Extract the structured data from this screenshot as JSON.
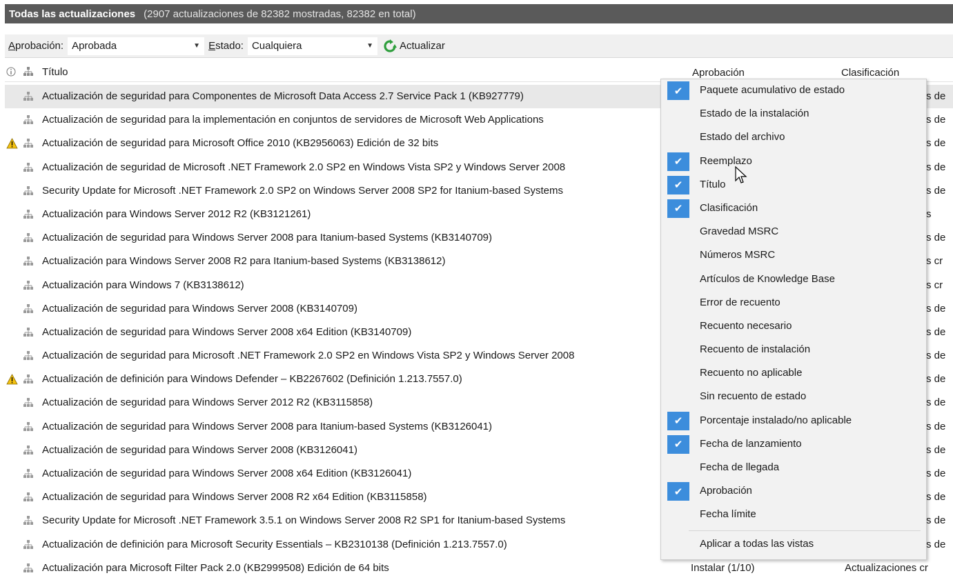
{
  "window": {
    "title": "Todas las actualizaciones",
    "subtitle": "(2907 actualizaciones de 82382 mostradas, 82382 en total)"
  },
  "toolbar": {
    "approval_label": "Aprobación:",
    "approval_value": "Aprobada",
    "status_label": "Estado:",
    "status_value": "Cualquiera",
    "refresh_label": "Actualizar"
  },
  "columns": {
    "title": "Título",
    "approval": "Aprobación",
    "classification": "Clasificación"
  },
  "rows": [
    {
      "title": "Actualización de seguridad para Componentes de Microsoft Data Access 2.7 Service Pack 1 (KB927779)",
      "warning": false,
      "selected": true,
      "approval": "",
      "classification": "s de"
    },
    {
      "title": "Actualización de seguridad para la implementación en conjuntos de servidores de Microsoft Web Applications",
      "warning": false,
      "approval": "",
      "classification": "s de"
    },
    {
      "title": "Actualización de seguridad para Microsoft Office 2010 (KB2956063) Edición de 32 bits",
      "warning": true,
      "approval": "",
      "classification": "s de"
    },
    {
      "title": "Actualización de seguridad de Microsoft .NET Framework 2.0 SP2 en Windows Vista SP2 y Windows Server 2008",
      "warning": false,
      "approval": "",
      "classification": "s de"
    },
    {
      "title": "Security Update for Microsoft .NET Framework 2.0 SP2 on Windows Server 2008 SP2 for Itanium-based Systems",
      "warning": false,
      "approval": "",
      "classification": "s de"
    },
    {
      "title": "Actualización para Windows Server 2012 R2 (KB3121261)",
      "warning": false,
      "approval": "",
      "classification": "s"
    },
    {
      "title": "Actualización de seguridad para Windows Server 2008 para Itanium-based Systems (KB3140709)",
      "warning": false,
      "approval": "",
      "classification": "s de"
    },
    {
      "title": "Actualización para Windows Server 2008 R2 para Itanium-based Systems (KB3138612)",
      "warning": false,
      "approval": "",
      "classification": "s cr"
    },
    {
      "title": "Actualización para Windows 7 (KB3138612)",
      "warning": false,
      "approval": "",
      "classification": "s cr"
    },
    {
      "title": "Actualización de seguridad para Windows Server 2008 (KB3140709)",
      "warning": false,
      "approval": "",
      "classification": "s de"
    },
    {
      "title": "Actualización de seguridad para Windows Server 2008 x64 Edition (KB3140709)",
      "warning": false,
      "approval": "",
      "classification": "s de"
    },
    {
      "title": "Actualización de seguridad para Microsoft .NET Framework 2.0 SP2 en Windows Vista SP2 y Windows Server 2008",
      "warning": false,
      "approval": "",
      "classification": "s de"
    },
    {
      "title": "Actualización de definición para Windows Defender – KB2267602 (Definición 1.213.7557.0)",
      "warning": true,
      "approval": "",
      "classification": "s de"
    },
    {
      "title": "Actualización de seguridad para Windows Server 2012 R2 (KB3115858)",
      "warning": false,
      "approval": "",
      "classification": "s de"
    },
    {
      "title": "Actualización de seguridad para Windows Server 2008 para Itanium-based Systems (KB3126041)",
      "warning": false,
      "approval": "",
      "classification": "s de"
    },
    {
      "title": "Actualización de seguridad para Windows Server 2008 (KB3126041)",
      "warning": false,
      "approval": "",
      "classification": "s de"
    },
    {
      "title": "Actualización de seguridad para Windows Server 2008 x64 Edition (KB3126041)",
      "warning": false,
      "approval": "",
      "classification": "s de"
    },
    {
      "title": "Actualización de seguridad para Windows Server 2008 R2 x64 Edition (KB3115858)",
      "warning": false,
      "approval": "",
      "classification": "s de"
    },
    {
      "title": "Security Update for Microsoft .NET Framework 3.5.1 on Windows Server 2008 R2 SP1 for Itanium-based Systems",
      "warning": false,
      "approval": "",
      "classification": "s de"
    },
    {
      "title": "Actualización de definición para Microsoft Security Essentials – KB2310138 (Definición 1.213.7557.0)",
      "warning": false,
      "approval": "",
      "classification": "s de"
    },
    {
      "title": "Actualización para Microsoft Filter Pack 2.0 (KB2999508) Edición de 64 bits",
      "warning": false,
      "approval": "Instalar (1/10)",
      "classification": "Actualizaciones cr"
    }
  ],
  "context_menu": {
    "items": [
      {
        "label": "Paquete acumulativo de estado",
        "checked": true
      },
      {
        "label": "Estado de la instalación",
        "checked": false
      },
      {
        "label": "Estado del archivo",
        "checked": false
      },
      {
        "label": "Reemplazo",
        "checked": true
      },
      {
        "label": "Título",
        "checked": true
      },
      {
        "label": "Clasificación",
        "checked": true
      },
      {
        "label": "Gravedad MSRC",
        "checked": false
      },
      {
        "label": "Números MSRC",
        "checked": false
      },
      {
        "label": "Artículos de Knowledge Base",
        "checked": false
      },
      {
        "label": "Error de recuento",
        "checked": false
      },
      {
        "label": "Recuento necesario",
        "checked": false
      },
      {
        "label": "Recuento de instalación",
        "checked": false
      },
      {
        "label": "Recuento no aplicable",
        "checked": false
      },
      {
        "label": "Sin recuento de estado",
        "checked": false
      },
      {
        "label": "Porcentaje instalado/no aplicable",
        "checked": true
      },
      {
        "label": "Fecha de lanzamiento",
        "checked": true
      },
      {
        "label": "Fecha de llegada",
        "checked": false
      },
      {
        "label": "Aprobación",
        "checked": true
      },
      {
        "label": "Fecha límite",
        "checked": false
      }
    ],
    "apply_all": "Aplicar a todas las vistas"
  },
  "colors": {
    "titlebar": "#5a5a5a",
    "check_accent": "#3c8ddc",
    "warning": "#f5c211",
    "refresh_green": "#2e9e3c"
  }
}
